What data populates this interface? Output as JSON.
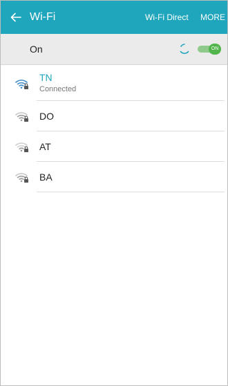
{
  "appbar": {
    "title": "Wi-Fi",
    "back_icon": "arrow-left-icon",
    "actions": {
      "wifi_direct": "Wi-Fi Direct",
      "more": "MORE"
    },
    "background_color": "#1fa6bd"
  },
  "master_switch": {
    "label": "On",
    "toggle_text": "ON",
    "state": "on",
    "scanning_icon": "spinner-icon",
    "toggle_color": "#51b54c"
  },
  "networks": [
    {
      "name": "TN",
      "status": "Connected",
      "icon": "wifi-locked-icon",
      "signal": "strong",
      "connected": true
    },
    {
      "name": "DO",
      "icon": "wifi-locked-icon",
      "signal": "medium",
      "connected": false
    },
    {
      "name": "AT",
      "icon": "wifi-locked-icon",
      "signal": "weak",
      "connected": false
    },
    {
      "name": "BA",
      "icon": "wifi-locked-icon",
      "signal": "medium",
      "connected": false
    }
  ],
  "colors": {
    "accent": "#1fa6bd",
    "icon_active": "#4a90c8",
    "icon_inactive": "#9e9e9e"
  }
}
